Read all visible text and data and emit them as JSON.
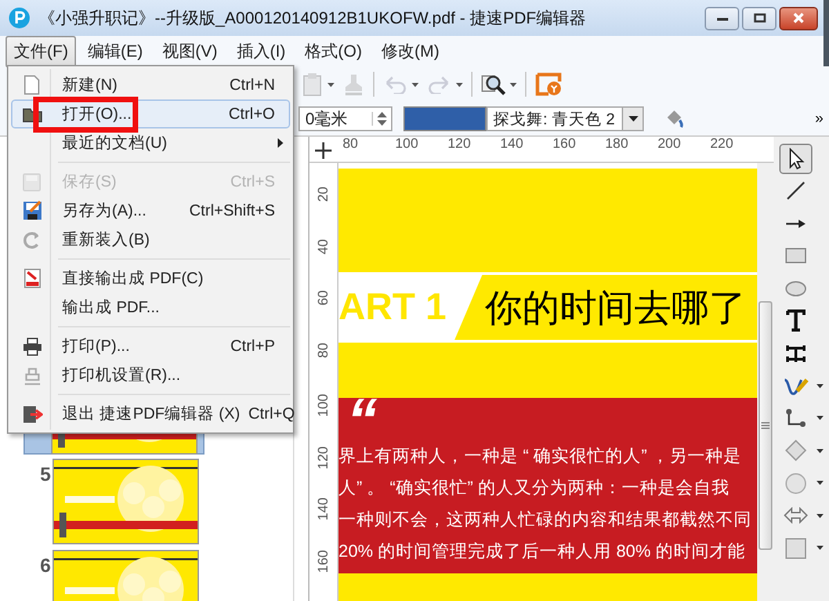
{
  "window": {
    "title": "《小强升职记》--升级版_A000120140912B1UKOFW.pdf - 捷速PDF编辑器"
  },
  "menubar": [
    {
      "label": "文件(F)",
      "selected": true
    },
    {
      "label": "编辑(E)",
      "selected": false
    },
    {
      "label": "视图(V)",
      "selected": false
    },
    {
      "label": "插入(I)",
      "selected": false
    },
    {
      "label": "格式(O)",
      "selected": false
    },
    {
      "label": "修改(M)",
      "selected": false
    }
  ],
  "file_menu": [
    {
      "kind": "item",
      "label": "新建(N)",
      "shortcut": "Ctrl+N",
      "disabled": false,
      "selected": false,
      "submenu": false
    },
    {
      "kind": "item",
      "label": "打开(O)...",
      "shortcut": "Ctrl+O",
      "disabled": false,
      "selected": true,
      "submenu": false
    },
    {
      "kind": "item",
      "label": "最近的文档(U)",
      "disabled": false,
      "selected": false,
      "submenu": true
    },
    {
      "kind": "separator"
    },
    {
      "kind": "item",
      "label": "保存(S)",
      "shortcut": "Ctrl+S",
      "disabled": true,
      "selected": false,
      "submenu": false
    },
    {
      "kind": "item",
      "label": "另存为(A)...",
      "shortcut": "Ctrl+Shift+S",
      "disabled": false,
      "selected": false,
      "submenu": false
    },
    {
      "kind": "item",
      "label": "重新装入(B)",
      "disabled": false,
      "selected": false,
      "submenu": false
    },
    {
      "kind": "separator"
    },
    {
      "kind": "item",
      "label": "直接输出成 PDF(C)",
      "disabled": false,
      "selected": false,
      "submenu": false
    },
    {
      "kind": "item",
      "label": "输出成 PDF...",
      "disabled": false,
      "selected": false,
      "submenu": false
    },
    {
      "kind": "separator"
    },
    {
      "kind": "item",
      "label": "打印(P)...",
      "shortcut": "Ctrl+P",
      "disabled": false,
      "selected": false,
      "submenu": false
    },
    {
      "kind": "item",
      "label": "打印机设置(R)...",
      "disabled": false,
      "selected": false,
      "submenu": false
    },
    {
      "kind": "separator"
    },
    {
      "kind": "item",
      "label": "退出 捷速PDF编辑器 (X)",
      "shortcut": "Ctrl+Q",
      "disabled": false,
      "selected": false,
      "submenu": false
    }
  ],
  "toolbar": [
    {
      "disabled": true
    },
    {
      "disabled": true
    },
    {
      "disabled": true
    },
    {
      "disabled": true
    },
    {
      "disabled": false
    },
    {
      "disabled": false
    }
  ],
  "format_bar": {
    "line_width": "0毫米",
    "fill_style": "探戈舞: 青天色 2",
    "more": "»"
  },
  "ruler": {
    "horizontal": [
      "80",
      "100",
      "120",
      "140",
      "160",
      "180",
      "200",
      "220"
    ],
    "vertical": [
      "20",
      "40",
      "60",
      "80",
      "100",
      "120",
      "140",
      "160"
    ]
  },
  "thumbnails": [
    {
      "selected": true
    },
    {
      "number": "5",
      "selected": false
    },
    {
      "number": "6",
      "selected": false
    }
  ],
  "page": {
    "part_label": "ART 1",
    "heading": "你的时间去哪了",
    "quote_mark": "“",
    "paragraph_lines": [
      "界上有两种人，一种是 “ 确实很忙的人” ，另一种是",
      "人” 。 “确实很忙” 的人又分为两种：一种是会自我",
      "一种则不会，这两种人忙碌的内容和结果都截然不同",
      "20% 的时间管理完成了后一种人用 80% 的时间才能"
    ]
  },
  "tools": [
    {
      "selected": true
    },
    {
      "selected": false
    },
    {
      "selected": false
    },
    {
      "selected": false
    },
    {
      "selected": false
    },
    {
      "selected": false
    },
    {
      "selected": false
    },
    {
      "selected": false
    },
    {
      "selected": false
    },
    {
      "selected": false
    },
    {
      "selected": false
    },
    {
      "selected": false
    },
    {
      "selected": false
    }
  ]
}
